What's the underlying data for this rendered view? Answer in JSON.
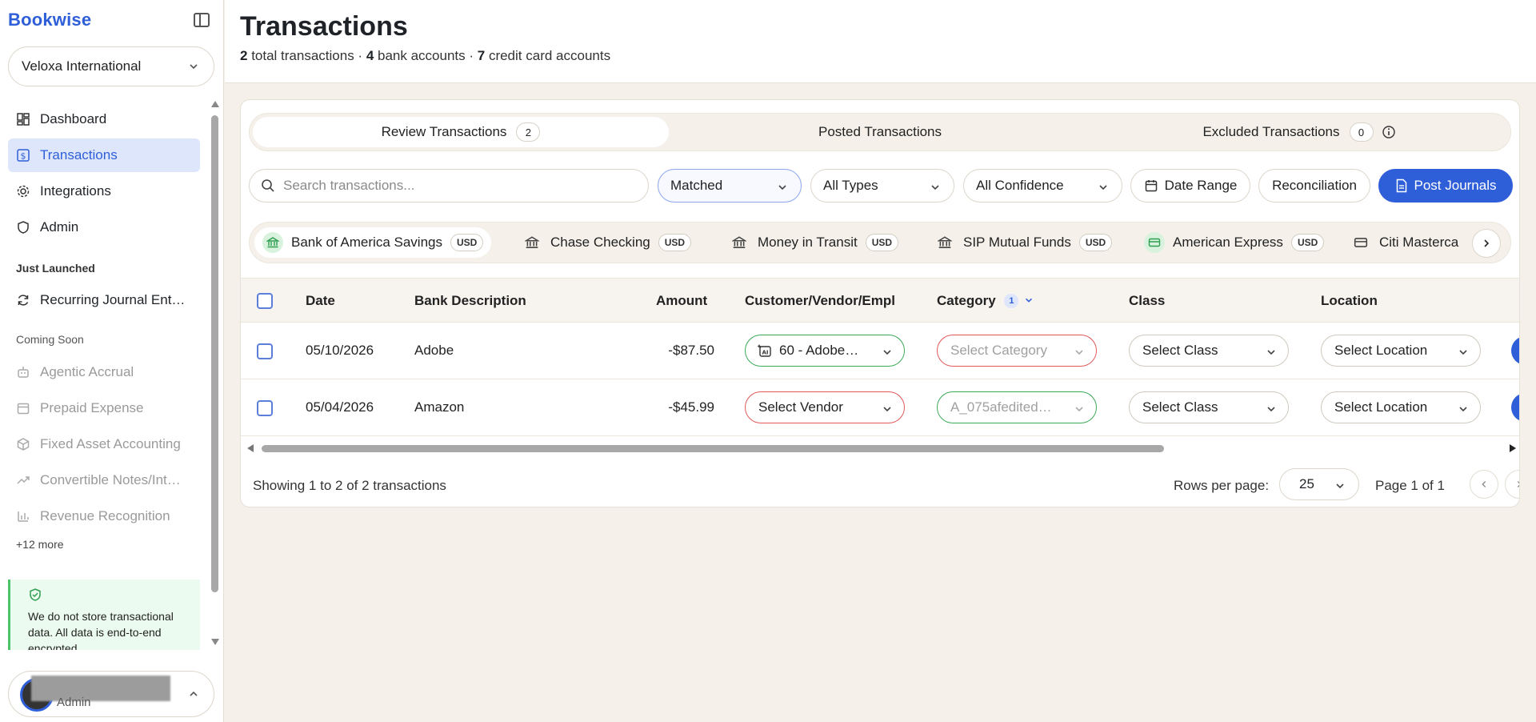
{
  "app": {
    "brand": "Bookwise"
  },
  "sidebar": {
    "org": "Veloxa International",
    "items": [
      {
        "label": "Dashboard",
        "icon": "dashboard-icon"
      },
      {
        "label": "Transactions",
        "icon": "dollar-icon",
        "active": true
      },
      {
        "label": "Integrations",
        "icon": "gear-icon"
      },
      {
        "label": "Admin",
        "icon": "shield-icon"
      }
    ],
    "just_launched_label": "Just Launched",
    "just_launched": [
      {
        "label": "Recurring Journal Ent…",
        "icon": "refresh-icon"
      }
    ],
    "coming_soon_label": "Coming Soon",
    "coming_soon": [
      {
        "label": "Agentic Accrual",
        "icon": "robot-icon"
      },
      {
        "label": "Prepaid Expense",
        "icon": "calendar-icon"
      },
      {
        "label": "Fixed Asset Accounting",
        "icon": "box-icon"
      },
      {
        "label": "Convertible Notes/Int…",
        "icon": "trend-icon"
      },
      {
        "label": "Revenue Recognition",
        "icon": "bar-chart-icon"
      }
    ],
    "more": "+12 more",
    "security_note": "We do not store transactional data. All data is end-to-end encrypted.",
    "user_role": "Admin"
  },
  "header": {
    "title": "Transactions",
    "total_count": "2",
    "total_label": " total transactions · ",
    "bank_count": "4",
    "bank_label": " bank accounts · ",
    "cc_count": "7",
    "cc_label": " credit card accounts"
  },
  "tabs": [
    {
      "label": "Review Transactions",
      "count": "2",
      "active": true
    },
    {
      "label": "Posted Transactions"
    },
    {
      "label": "Excluded Transactions",
      "count": "0"
    }
  ],
  "toolbar": {
    "search_placeholder": "Search transactions...",
    "status_filter": "Matched",
    "type_filter": "All Types",
    "confidence_filter": "All Confidence",
    "date_range": "Date Range",
    "reconciliation": "Reconciliation",
    "post_journals": "Post Journals"
  },
  "accounts": [
    {
      "name": "Bank of America Savings",
      "currency": "USD",
      "type": "bank",
      "active": true
    },
    {
      "name": "Chase Checking",
      "currency": "USD",
      "type": "bank"
    },
    {
      "name": "Money in Transit",
      "currency": "USD",
      "type": "bank"
    },
    {
      "name": "SIP Mutual Funds",
      "currency": "USD",
      "type": "bank"
    },
    {
      "name": "American Express",
      "currency": "USD",
      "type": "card"
    },
    {
      "name": "Citi Masterca",
      "currency": "",
      "type": "card"
    }
  ],
  "table": {
    "headers": {
      "date": "Date",
      "description": "Bank Description",
      "amount": "Amount",
      "vendor": "Customer/Vendor/Empl",
      "category": "Category",
      "category_badge": "1",
      "class": "Class",
      "location": "Location"
    },
    "rows": [
      {
        "date": "05/10/2026",
        "description": "Adobe",
        "amount": "-$87.50",
        "vendor": "60 - Adobe…",
        "category": "Select Category",
        "class": "Select Class",
        "location": "Select Location"
      },
      {
        "date": "05/04/2026",
        "description": "Amazon",
        "amount": "-$45.99",
        "vendor": "Select Vendor",
        "category": "A_075afedited…",
        "class": "Select Class",
        "location": "Select Location"
      }
    ]
  },
  "footer": {
    "showing": "Showing 1 to 2 of 2 transactions",
    "rows_per_page_label": "Rows per page:",
    "rows_per_page": "25",
    "page_info": "Page 1 of 1"
  },
  "colors": {
    "accent": "#2f5fd8",
    "success": "#3aa957",
    "danger": "#e05858",
    "background": "#f5f1ea"
  }
}
